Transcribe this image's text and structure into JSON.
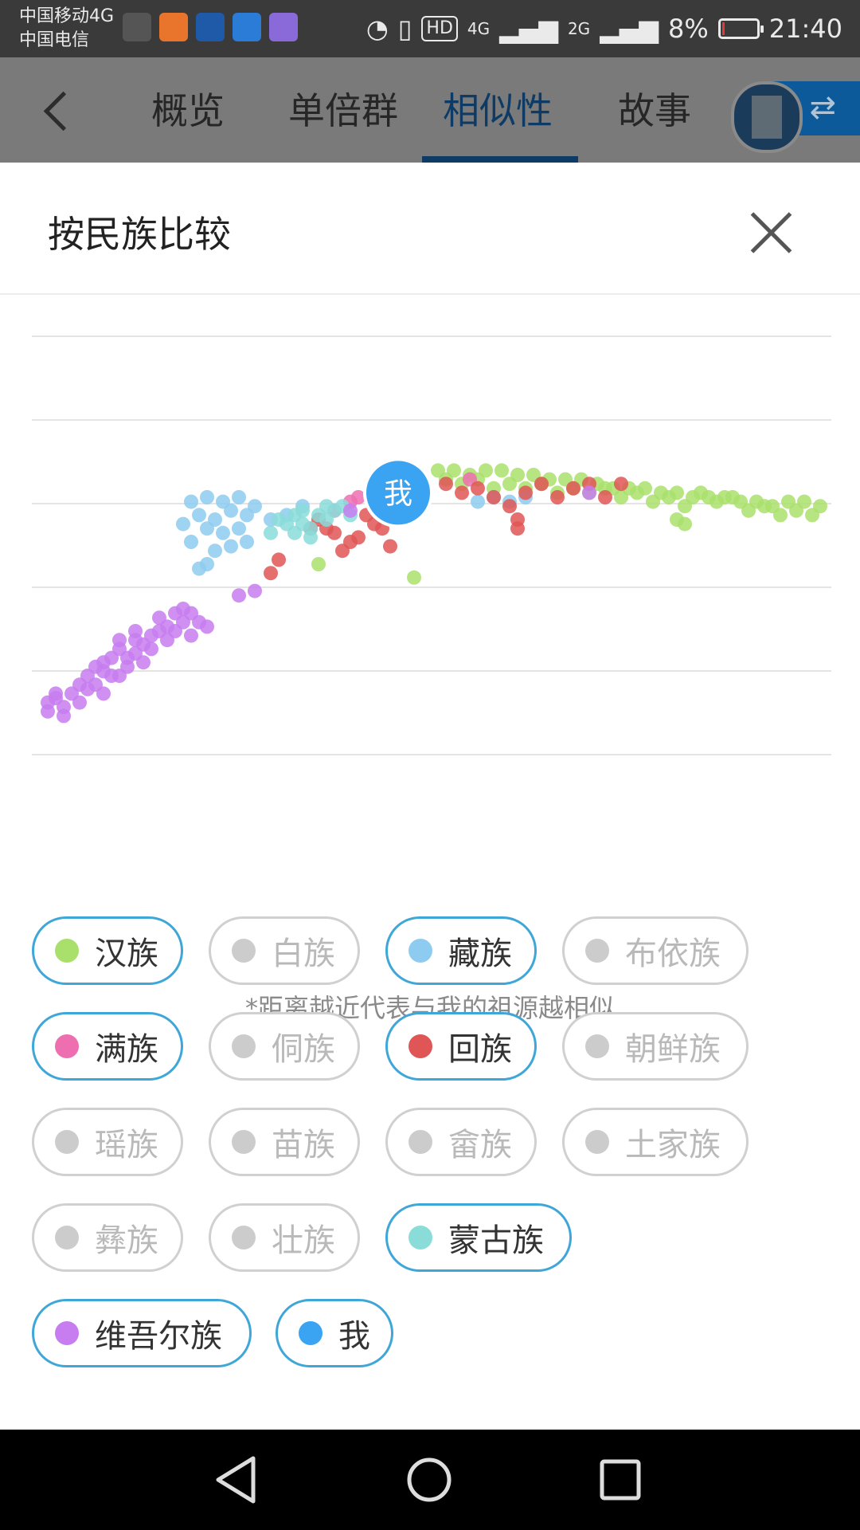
{
  "status_bar": {
    "carrier_1": "中国移动4G",
    "carrier_2": "中国电信",
    "hd": "HD",
    "net_1": "4G",
    "net_2": "2G",
    "battery": "8%",
    "battery_level": 0.08,
    "time": "21:40",
    "app_icons": [
      "qq-penguin-icon",
      "uc-browser-icon",
      "bank-app-icon",
      "shield-app-icon",
      "chat-app-icon"
    ]
  },
  "header": {
    "tabs": [
      {
        "label": "概览",
        "active": false
      },
      {
        "label": "单倍群",
        "active": false
      },
      {
        "label": "相似性",
        "active": true
      },
      {
        "label": "故事",
        "active": false
      }
    ],
    "switch_icon": "⇄"
  },
  "sheet": {
    "title": "按民族比较",
    "me_marker": "我",
    "footnote": "*距离越近代表与我的祖源越相似"
  },
  "legend": [
    {
      "label": "汉族",
      "color": "#a9e06b",
      "on": true
    },
    {
      "label": "白族",
      "color": "#cccccc",
      "on": false
    },
    {
      "label": "藏族",
      "color": "#8ecbf0",
      "on": true
    },
    {
      "label": "布依族",
      "color": "#cccccc",
      "on": false
    },
    {
      "label": "满族",
      "color": "#ee6fb0",
      "on": true
    },
    {
      "label": "侗族",
      "color": "#cccccc",
      "on": false
    },
    {
      "label": "回族",
      "color": "#e05656",
      "on": true
    },
    {
      "label": "朝鲜族",
      "color": "#cccccc",
      "on": false
    },
    {
      "label": "瑶族",
      "color": "#cccccc",
      "on": false
    },
    {
      "label": "苗族",
      "color": "#cccccc",
      "on": false
    },
    {
      "label": "畲族",
      "color": "#cccccc",
      "on": false
    },
    {
      "label": "土家族",
      "color": "#cccccc",
      "on": false
    },
    {
      "label": "彝族",
      "color": "#cccccc",
      "on": false
    },
    {
      "label": "壮族",
      "color": "#cccccc",
      "on": false
    },
    {
      "label": "蒙古族",
      "color": "#8adcd9",
      "on": true
    },
    {
      "label": "维吾尔族",
      "color": "#c77cf0",
      "on": true
    },
    {
      "label": "我",
      "color": "#3aa4f2",
      "on": true
    }
  ],
  "chart_data": {
    "type": "scatter",
    "grid": true,
    "series": [
      {
        "name": "汉族",
        "color": "#a9e06b",
        "points": [
          [
            0.51,
            0.34
          ],
          [
            0.53,
            0.34
          ],
          [
            0.55,
            0.35
          ],
          [
            0.57,
            0.34
          ],
          [
            0.59,
            0.34
          ],
          [
            0.61,
            0.35
          ],
          [
            0.63,
            0.35
          ],
          [
            0.65,
            0.36
          ],
          [
            0.67,
            0.36
          ],
          [
            0.69,
            0.36
          ],
          [
            0.71,
            0.37
          ],
          [
            0.73,
            0.38
          ],
          [
            0.75,
            0.38
          ],
          [
            0.77,
            0.38
          ],
          [
            0.79,
            0.39
          ],
          [
            0.81,
            0.39
          ],
          [
            0.83,
            0.4
          ],
          [
            0.85,
            0.4
          ],
          [
            0.87,
            0.4
          ],
          [
            0.89,
            0.41
          ],
          [
            0.91,
            0.41
          ],
          [
            0.93,
            0.42
          ],
          [
            0.95,
            0.41
          ],
          [
            0.97,
            0.41
          ],
          [
            0.99,
            0.42
          ],
          [
            0.54,
            0.37
          ],
          [
            0.58,
            0.38
          ],
          [
            0.62,
            0.38
          ],
          [
            0.66,
            0.39
          ],
          [
            0.7,
            0.39
          ],
          [
            0.74,
            0.4
          ],
          [
            0.78,
            0.41
          ],
          [
            0.82,
            0.42
          ],
          [
            0.86,
            0.41
          ],
          [
            0.9,
            0.43
          ],
          [
            0.94,
            0.44
          ],
          [
            0.98,
            0.44
          ],
          [
            0.52,
            0.36
          ],
          [
            0.56,
            0.36
          ],
          [
            0.6,
            0.37
          ],
          [
            0.64,
            0.37
          ],
          [
            0.68,
            0.38
          ],
          [
            0.72,
            0.38
          ],
          [
            0.76,
            0.39
          ],
          [
            0.8,
            0.4
          ],
          [
            0.84,
            0.39
          ],
          [
            0.88,
            0.4
          ],
          [
            0.92,
            0.42
          ],
          [
            0.96,
            0.43
          ],
          [
            0.81,
            0.45
          ],
          [
            0.82,
            0.46
          ],
          [
            0.36,
            0.55
          ],
          [
            0.48,
            0.58
          ]
        ]
      },
      {
        "name": "藏族",
        "color": "#8ecbf0",
        "points": [
          [
            0.2,
            0.41
          ],
          [
            0.22,
            0.4
          ],
          [
            0.24,
            0.41
          ],
          [
            0.26,
            0.4
          ],
          [
            0.28,
            0.42
          ],
          [
            0.21,
            0.44
          ],
          [
            0.23,
            0.45
          ],
          [
            0.25,
            0.43
          ],
          [
            0.27,
            0.44
          ],
          [
            0.19,
            0.46
          ],
          [
            0.22,
            0.47
          ],
          [
            0.24,
            0.48
          ],
          [
            0.26,
            0.47
          ],
          [
            0.3,
            0.45
          ],
          [
            0.32,
            0.44
          ],
          [
            0.34,
            0.42
          ],
          [
            0.2,
            0.5
          ],
          [
            0.23,
            0.52
          ],
          [
            0.25,
            0.51
          ],
          [
            0.27,
            0.5
          ],
          [
            0.22,
            0.55
          ],
          [
            0.21,
            0.56
          ],
          [
            0.56,
            0.41
          ],
          [
            0.58,
            0.4
          ],
          [
            0.6,
            0.41
          ],
          [
            0.62,
            0.4
          ]
        ]
      },
      {
        "name": "满族",
        "color": "#ee6fb0",
        "points": [
          [
            0.55,
            0.36
          ],
          [
            0.4,
            0.41
          ],
          [
            0.41,
            0.4
          ],
          [
            0.38,
            0.43
          ]
        ]
      },
      {
        "name": "回族",
        "color": "#e05656",
        "points": [
          [
            0.52,
            0.37
          ],
          [
            0.54,
            0.39
          ],
          [
            0.56,
            0.38
          ],
          [
            0.58,
            0.4
          ],
          [
            0.6,
            0.42
          ],
          [
            0.62,
            0.39
          ],
          [
            0.64,
            0.37
          ],
          [
            0.66,
            0.4
          ],
          [
            0.68,
            0.38
          ],
          [
            0.7,
            0.37
          ],
          [
            0.72,
            0.4
          ],
          [
            0.74,
            0.37
          ],
          [
            0.42,
            0.44
          ],
          [
            0.43,
            0.46
          ],
          [
            0.44,
            0.47
          ],
          [
            0.4,
            0.5
          ],
          [
            0.39,
            0.52
          ],
          [
            0.41,
            0.49
          ],
          [
            0.45,
            0.51
          ],
          [
            0.37,
            0.47
          ],
          [
            0.38,
            0.48
          ],
          [
            0.36,
            0.45
          ],
          [
            0.35,
            0.47
          ],
          [
            0.31,
            0.54
          ],
          [
            0.3,
            0.57
          ],
          [
            0.61,
            0.45
          ],
          [
            0.61,
            0.47
          ]
        ]
      },
      {
        "name": "蒙古族",
        "color": "#8adcd9",
        "points": [
          [
            0.31,
            0.45
          ],
          [
            0.33,
            0.44
          ],
          [
            0.34,
            0.46
          ],
          [
            0.35,
            0.47
          ],
          [
            0.36,
            0.44
          ],
          [
            0.37,
            0.45
          ],
          [
            0.38,
            0.43
          ],
          [
            0.33,
            0.48
          ],
          [
            0.35,
            0.49
          ],
          [
            0.37,
            0.42
          ],
          [
            0.39,
            0.42
          ],
          [
            0.4,
            0.44
          ],
          [
            0.32,
            0.46
          ],
          [
            0.3,
            0.48
          ],
          [
            0.34,
            0.43
          ]
        ]
      },
      {
        "name": "维吾尔族",
        "color": "#c77cf0",
        "points": [
          [
            0.02,
            0.86
          ],
          [
            0.03,
            0.85
          ],
          [
            0.04,
            0.87
          ],
          [
            0.05,
            0.84
          ],
          [
            0.06,
            0.86
          ],
          [
            0.07,
            0.83
          ],
          [
            0.08,
            0.82
          ],
          [
            0.09,
            0.84
          ],
          [
            0.1,
            0.8
          ],
          [
            0.07,
            0.8
          ],
          [
            0.08,
            0.78
          ],
          [
            0.09,
            0.77
          ],
          [
            0.1,
            0.76
          ],
          [
            0.11,
            0.74
          ],
          [
            0.12,
            0.76
          ],
          [
            0.13,
            0.72
          ],
          [
            0.14,
            0.73
          ],
          [
            0.15,
            0.71
          ],
          [
            0.16,
            0.7
          ],
          [
            0.17,
            0.69
          ],
          [
            0.18,
            0.7
          ],
          [
            0.19,
            0.68
          ],
          [
            0.17,
            0.72
          ],
          [
            0.15,
            0.74
          ],
          [
            0.13,
            0.75
          ],
          [
            0.12,
            0.78
          ],
          [
            0.11,
            0.8
          ],
          [
            0.14,
            0.77
          ],
          [
            0.16,
            0.67
          ],
          [
            0.18,
            0.66
          ],
          [
            0.19,
            0.65
          ],
          [
            0.2,
            0.66
          ],
          [
            0.21,
            0.68
          ],
          [
            0.22,
            0.69
          ],
          [
            0.2,
            0.71
          ],
          [
            0.09,
            0.79
          ],
          [
            0.06,
            0.82
          ],
          [
            0.03,
            0.84
          ],
          [
            0.11,
            0.72
          ],
          [
            0.13,
            0.7
          ],
          [
            0.26,
            0.62
          ],
          [
            0.28,
            0.61
          ],
          [
            0.4,
            0.43
          ],
          [
            0.7,
            0.39
          ],
          [
            0.02,
            0.88
          ],
          [
            0.04,
            0.89
          ]
        ]
      },
      {
        "name": "我",
        "color": "#3aa4f2",
        "points": [
          [
            0.46,
            0.39
          ]
        ]
      }
    ]
  }
}
